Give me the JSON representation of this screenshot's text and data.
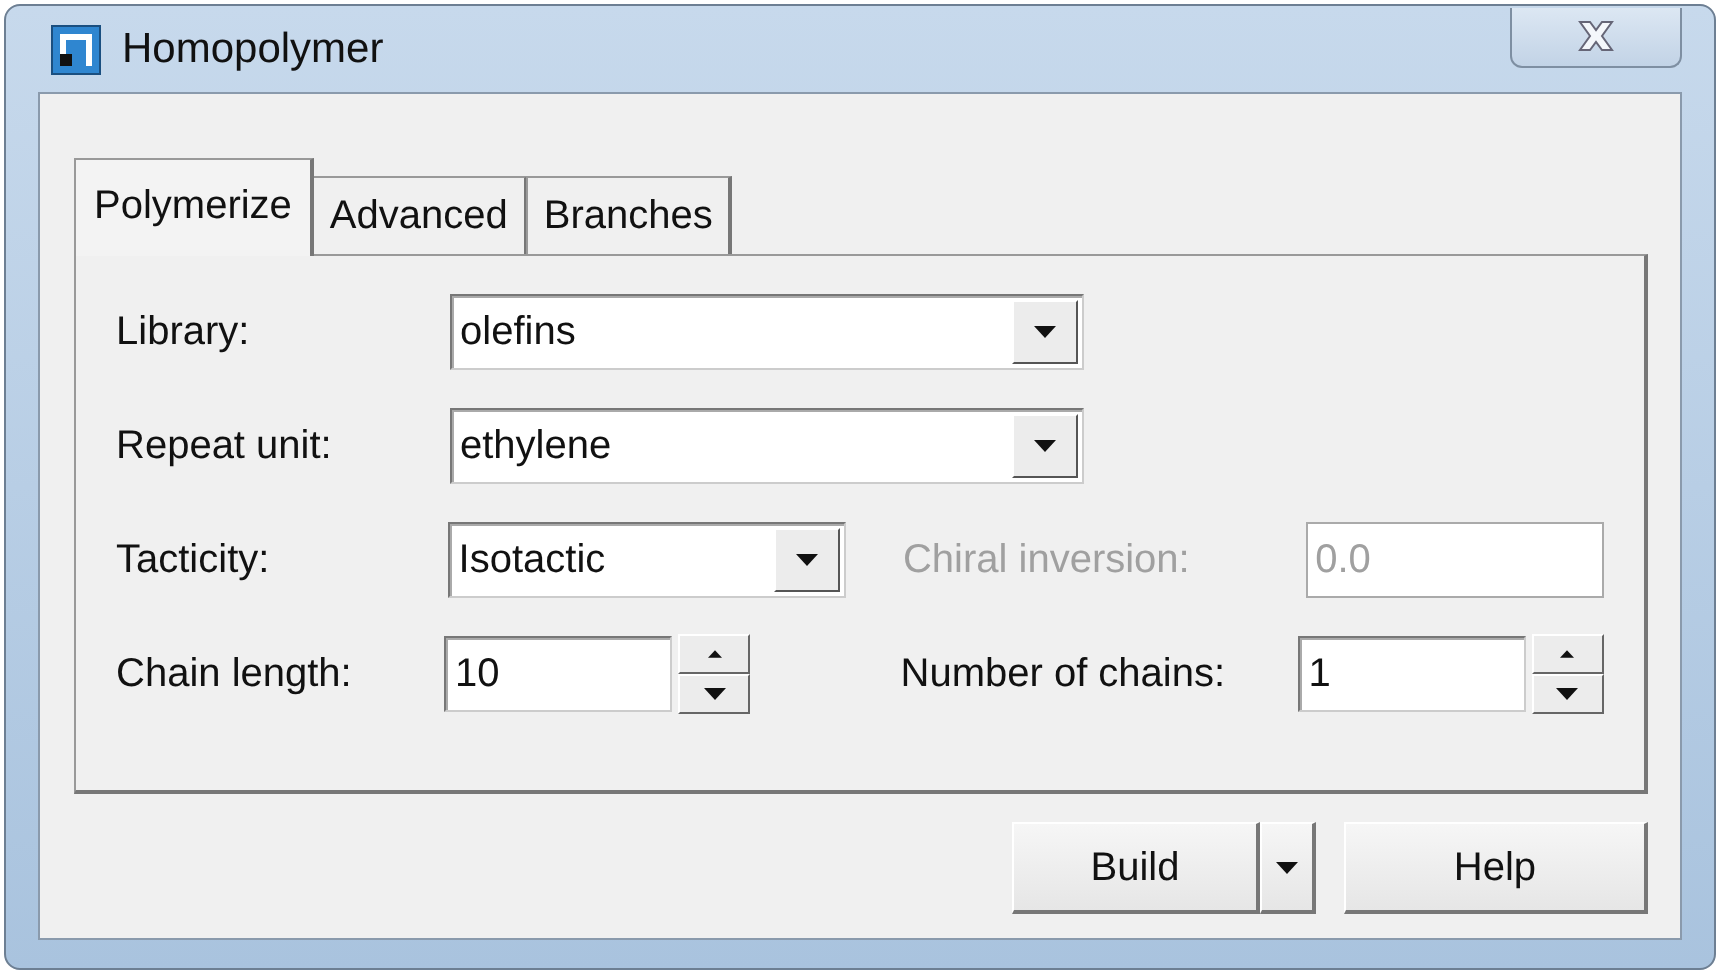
{
  "window": {
    "title": "Homopolymer"
  },
  "tabs": [
    {
      "label": "Polymerize",
      "selected": true
    },
    {
      "label": "Advanced",
      "selected": false
    },
    {
      "label": "Branches",
      "selected": false
    }
  ],
  "rows": [
    [
      {
        "kind": "combo",
        "label": "Library:",
        "value": "olefins",
        "disabled": false
      }
    ],
    [
      {
        "kind": "combo",
        "label": "Repeat unit:",
        "value": "ethylene",
        "disabled": false
      }
    ],
    [
      {
        "kind": "combo",
        "label": "Tacticity:",
        "value": "Isotactic",
        "disabled": false
      },
      {
        "kind": "text",
        "label": "Chiral inversion:",
        "value": "0.0",
        "disabled": true
      }
    ],
    [
      {
        "kind": "spin",
        "label": "Chain length:",
        "value": "10",
        "disabled": false
      },
      {
        "kind": "spin",
        "label": "Number of chains:",
        "value": "1",
        "disabled": false
      }
    ]
  ],
  "buttons": [
    {
      "label": "Build",
      "kind": "split"
    },
    {
      "label": "Help",
      "kind": "plain"
    }
  ]
}
